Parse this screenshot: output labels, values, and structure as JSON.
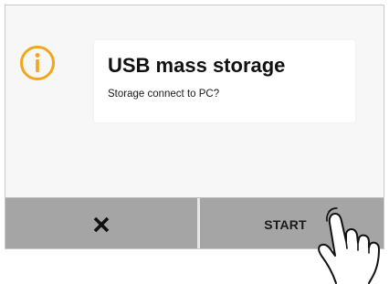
{
  "dialog": {
    "icon": "info-icon",
    "title": "USB mass storage",
    "message": "Storage connect to PC?"
  },
  "buttons": {
    "cancel_icon": "close-icon",
    "start_label": "START"
  },
  "overlay": {
    "pointer": "hand-pointer-icon"
  },
  "colors": {
    "accent": "#f3a51c",
    "button_bar": "#a5a5a5",
    "screen_bg": "#f7f7f7",
    "message_box": "#ffffff"
  }
}
